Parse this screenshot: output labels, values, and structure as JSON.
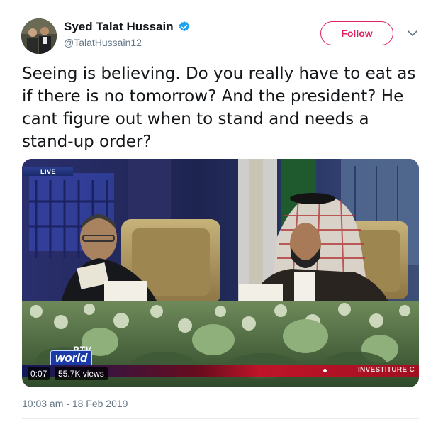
{
  "author": {
    "display_name": "Syed Talat Hussain",
    "handle": "@TalatHussain12",
    "verified": true
  },
  "follow_button": {
    "label": "Follow",
    "color": "#e0245e"
  },
  "tweet": {
    "text": "Seeing is believing. Do you really have to eat as if there is no tomorrow? And the president? He cant figure out when to stand and needs a stand-up order?",
    "timestamp": "10:03 am - 18 Feb 2019"
  },
  "video": {
    "live_label": "LIVE",
    "channel_prefix": "PTV",
    "channel_name": "world",
    "ticker_text": "INVESTITURE C",
    "duration": "0:07",
    "views": "55.7K views"
  },
  "icons": {
    "verified": "verified-badge-icon",
    "caret": "chevron-down-icon"
  },
  "colors": {
    "verified_blue": "#1da1f2",
    "secondary_text": "#657786"
  }
}
